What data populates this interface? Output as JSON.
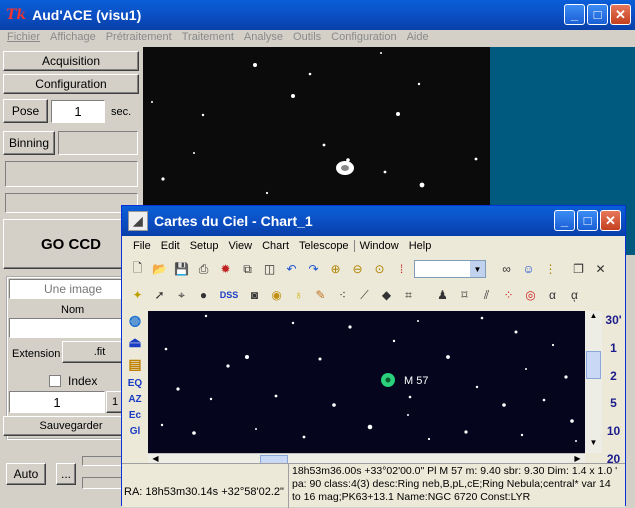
{
  "audace": {
    "title": "Aud'ACE (visu1)",
    "title_glyph": "Tk",
    "menu": [
      "Fichier",
      "Affichage",
      "Prétraitement",
      "Traitement",
      "Analyse",
      "Outils",
      "Configuration",
      "Aide"
    ],
    "panel": {
      "acquisition": "Acquisition",
      "configuration": "Configuration",
      "pose_label": "Pose",
      "pose_value": "1",
      "pose_unit": "sec.",
      "binning_label": "Binning",
      "go_ccd": "GO CCD",
      "image_mode": "Une image",
      "nom_label": "Nom",
      "nom_value": "",
      "extension_label": "Extension",
      "extension_value": ".fit",
      "index_label": "Index",
      "index_value": "1",
      "index_spin": "1",
      "save": "Sauvegarder",
      "auto": "Auto",
      "ellipsis": "..."
    },
    "colors": {
      "image_bg": "#0b0b0b",
      "side_bg": "#005a80"
    }
  },
  "cdc": {
    "title": "Cartes du Ciel - Chart_1",
    "menu": [
      "File",
      "Edit",
      "Setup",
      "View",
      "Chart",
      "Telescope",
      "Window",
      "Help"
    ],
    "toolbar1_icons": [
      "new-chart-icon",
      "open-icon",
      "save-icon",
      "print-icon",
      "settings-icon",
      "copy-icon",
      "split-icon",
      "undo-icon",
      "redo-icon",
      "zoom-in-icon",
      "zoom-out-icon",
      "zoom-fit-icon",
      "color-icon"
    ],
    "toolbar2_icons": [
      "star-icon",
      "select-icon",
      "constellation-icon",
      "eye-icon",
      "camera-icon",
      "planet-icon",
      "lamp-icon",
      "pencil-icon",
      "link-icon",
      "brush-icon",
      "grid-icon",
      "figure-icon",
      "lines-icon",
      "target-icon",
      "alpha-icon"
    ],
    "dss_label": "DSS",
    "alpha_label": "α",
    "left_strip": [
      "EQ",
      "AZ",
      "Ec",
      "Gl"
    ],
    "fov_scale": [
      "30'",
      "1",
      "2",
      "5",
      "10",
      "20"
    ],
    "object_label": "M 57",
    "status": {
      "coords": "RA: 18h53m30.14s +32°58'02.2\"",
      "info": "18h53m36.00s +33°02'00.0\" Pl M 57 m: 9.40 sbr: 9.30 Dim: 1.4 x 1.0 ' pa: 90 class:4(3) desc:Ring neb,B,pL,cE;Ring Nebula;central* var 14 to 16 mag;PK63+13.1 Name:NGC 6720 Const:LYR"
    },
    "colors": {
      "sky_bg": "#05051e",
      "object": "#2bd07a",
      "title_bar": "#0b4fc4"
    }
  }
}
